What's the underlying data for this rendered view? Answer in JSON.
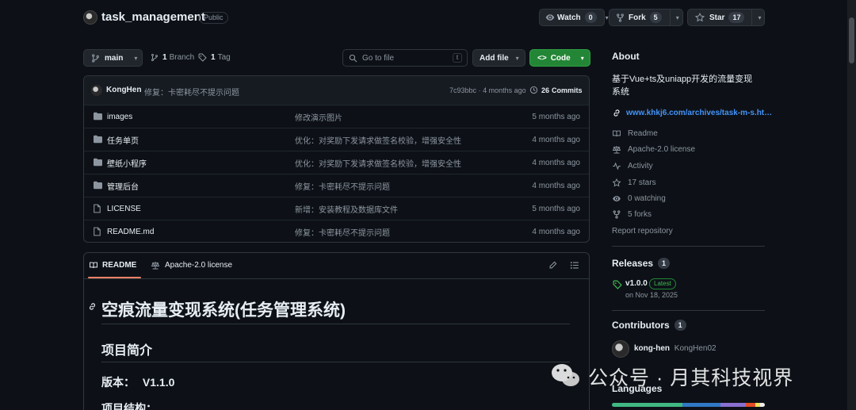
{
  "repo": {
    "name": "task_management",
    "visibility": "Public"
  },
  "actions": {
    "watch": {
      "label": "Watch",
      "count": "0"
    },
    "fork": {
      "label": "Fork",
      "count": "5"
    },
    "star": {
      "label": "Star",
      "count": "17"
    }
  },
  "toolbar": {
    "branch": "main",
    "branches_count": "1",
    "branches_label": "Branch",
    "tags_count": "1",
    "tags_label": "Tag",
    "search_placeholder": "Go to file",
    "search_shortcut": "t",
    "add_file": "Add file",
    "code": "Code"
  },
  "commit": {
    "author": "KongHen",
    "message": "修复：卡密耗尽不提示问题",
    "hash": "7c93bbc",
    "dot": "·",
    "time": "4 months ago",
    "commits_count": "26",
    "commits_label": "Commits"
  },
  "files": [
    {
      "name": "images",
      "type": "folder",
      "message": "修改演示图片",
      "time": "5 months ago"
    },
    {
      "name": "任务单页",
      "type": "folder",
      "message": "优化：对奖励下发请求做签名校验，增强安全性",
      "time": "4 months ago"
    },
    {
      "name": "壁纸小程序",
      "type": "folder",
      "message": "优化：对奖励下发请求做签名校验，增强安全性",
      "time": "4 months ago"
    },
    {
      "name": "管理后台",
      "type": "folder",
      "message": "修复：卡密耗尽不提示问题",
      "time": "4 months ago"
    },
    {
      "name": "LICENSE",
      "type": "file",
      "message": "新增：安装教程及数据库文件",
      "time": "5 months ago"
    },
    {
      "name": "README.md",
      "type": "file",
      "message": "修复：卡密耗尽不提示问题",
      "time": "4 months ago"
    }
  ],
  "readme": {
    "tab_readme": "README",
    "tab_license": "Apache-2.0 license",
    "h1": "空痕流量变现系统(任务管理系统)",
    "h2": "项目简介",
    "version_label": "版本：",
    "version_value": "V1.1.0",
    "structure_label": "项目结构："
  },
  "about": {
    "heading": "About",
    "description_line1": "基于Vue+ts及uniapp开发的流量变现",
    "description_line2": "系统",
    "link": "www.khkj6.com/archives/task-m-s.ht…",
    "readme": "Readme",
    "license": "Apache-2.0 license",
    "activity": "Activity",
    "stars": "17 stars",
    "watching": "0 watching",
    "forks": "5 forks",
    "report": "Report repository"
  },
  "releases": {
    "heading": "Releases",
    "count": "1",
    "tag": "v1.0.0",
    "badge": "Latest",
    "date": "on Nov 18, 2025"
  },
  "contributors": {
    "heading": "Contributors",
    "count": "1",
    "username": "kong-hen",
    "fullname": "KongHen02"
  },
  "languages": {
    "heading": "Languages"
  },
  "watermark": {
    "text": "公众号 · 月其科技视界"
  },
  "colors": {
    "bg": "#0d1117",
    "accent_green": "#238636",
    "link_blue": "#4493f8",
    "border": "#30363d"
  }
}
